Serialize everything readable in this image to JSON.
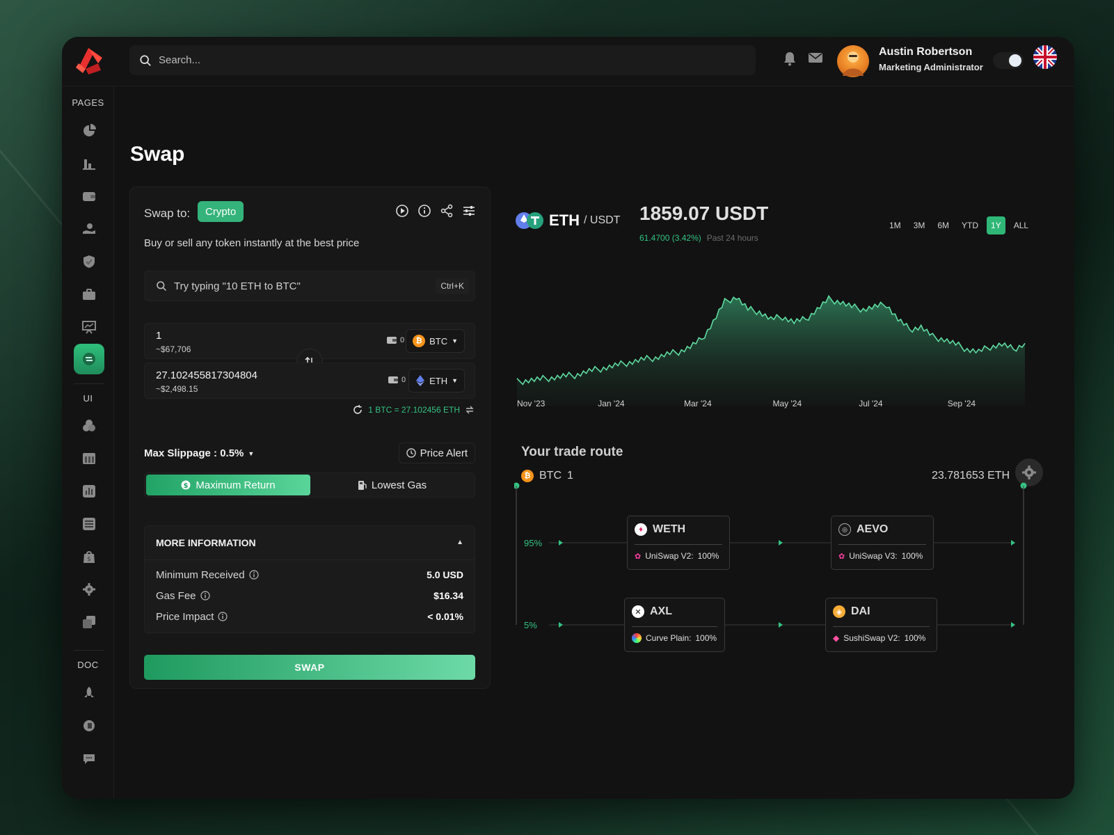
{
  "colors": {
    "accent": "#2fb777",
    "bg": "#121212",
    "btc": "#f7931a",
    "eth": "#627eea"
  },
  "header": {
    "search_placeholder": "Search...",
    "user_name": "Austin Robertson",
    "user_role": "Marketing Administrator",
    "theme": "dark"
  },
  "sidebar": {
    "sections": [
      "PAGES",
      "UI",
      "DOC"
    ],
    "pages_icons": [
      "pie-chart-icon",
      "bar-chart-icon",
      "wallet-icon",
      "coins-icon",
      "shield-icon",
      "briefcase-icon",
      "presentation-icon",
      "swap-icon"
    ],
    "ui_icons": [
      "circles-icon",
      "table-icon",
      "chart-box-icon",
      "list-icon",
      "bag-icon",
      "settings-icon",
      "copy-icon"
    ],
    "doc_icons": [
      "rocket-icon",
      "puzzle-icon",
      "chat-icon"
    ],
    "active": "swap-icon"
  },
  "page": {
    "title": "Swap"
  },
  "swap": {
    "swap_to_label": "Swap to:",
    "mode": "Crypto",
    "subtitle": "Buy or sell any token instantly at the best price",
    "command_placeholder": "Try typing \"10 ETH to BTC\"",
    "shortcut": "Ctrl+K",
    "from": {
      "amount": "1",
      "usd": "~$67,706",
      "balance": "0",
      "token": "BTC"
    },
    "to": {
      "amount": "27.102455817304804",
      "usd": "~$2,498.15",
      "balance": "0",
      "token": "ETH"
    },
    "rate": "1 BTC = 27.102456 ETH",
    "max_slippage": "Max Slippage : 0.5%",
    "price_alert": "Price Alert",
    "modes": [
      "Maximum Return",
      "Lowest Gas"
    ],
    "more_info": {
      "heading": "MORE INFORMATION",
      "rows": [
        {
          "label": "Minimum Received",
          "value": "5.0 USD"
        },
        {
          "label": "Gas Fee",
          "value": "$16.34"
        },
        {
          "label": "Price Impact",
          "value": "< 0.01%"
        }
      ]
    },
    "button": "SWAP"
  },
  "market": {
    "pair_base": "ETH",
    "pair_quote": "/ USDT",
    "price": "1859.07 USDT",
    "change": "61.4700 (3.42%)",
    "change_note": "Past 24 hours",
    "ranges": [
      "1M",
      "3M",
      "6M",
      "YTD",
      "1Y",
      "ALL"
    ],
    "active_range": "1Y"
  },
  "chart_data": {
    "type": "area",
    "x_tick_labels": [
      "Nov '23",
      "Jan '24",
      "Mar '24",
      "May '24",
      "Jul '24",
      "Sep '24"
    ],
    "series": [
      {
        "values": [
          1850,
          1880,
          1900,
          1930,
          1960,
          1980,
          2050,
          2100,
          2150,
          2200,
          2250,
          2300,
          2330,
          2400,
          2450,
          2550,
          2700,
          3050,
          3450,
          3550,
          3300,
          3250,
          3100,
          3150,
          3050,
          3100,
          3300,
          3500,
          3450,
          3350,
          3300,
          3350,
          3400,
          3100,
          2900,
          2950,
          2750,
          2700,
          2600,
          2500,
          2450,
          2550,
          2600,
          2500,
          2620
        ]
      }
    ],
    "grid": false,
    "legend": "none"
  },
  "route": {
    "title": "Your trade route",
    "from_token": "BTC",
    "from_amount": "1",
    "to_amount": "23.781653",
    "to_token": "ETH",
    "paths": [
      {
        "pct": "95%",
        "hops": [
          {
            "token": "WETH",
            "dex": "UniSwap V2:",
            "share": "100%"
          },
          {
            "token": "AEVO",
            "dex": "UniSwap V3:",
            "share": "100%"
          }
        ]
      },
      {
        "pct": "5%",
        "hops": [
          {
            "token": "AXL",
            "dex": "Curve Plain:",
            "share": "100%"
          },
          {
            "token": "DAI",
            "dex": "SushiSwap V2:",
            "share": "100%"
          }
        ]
      }
    ]
  }
}
